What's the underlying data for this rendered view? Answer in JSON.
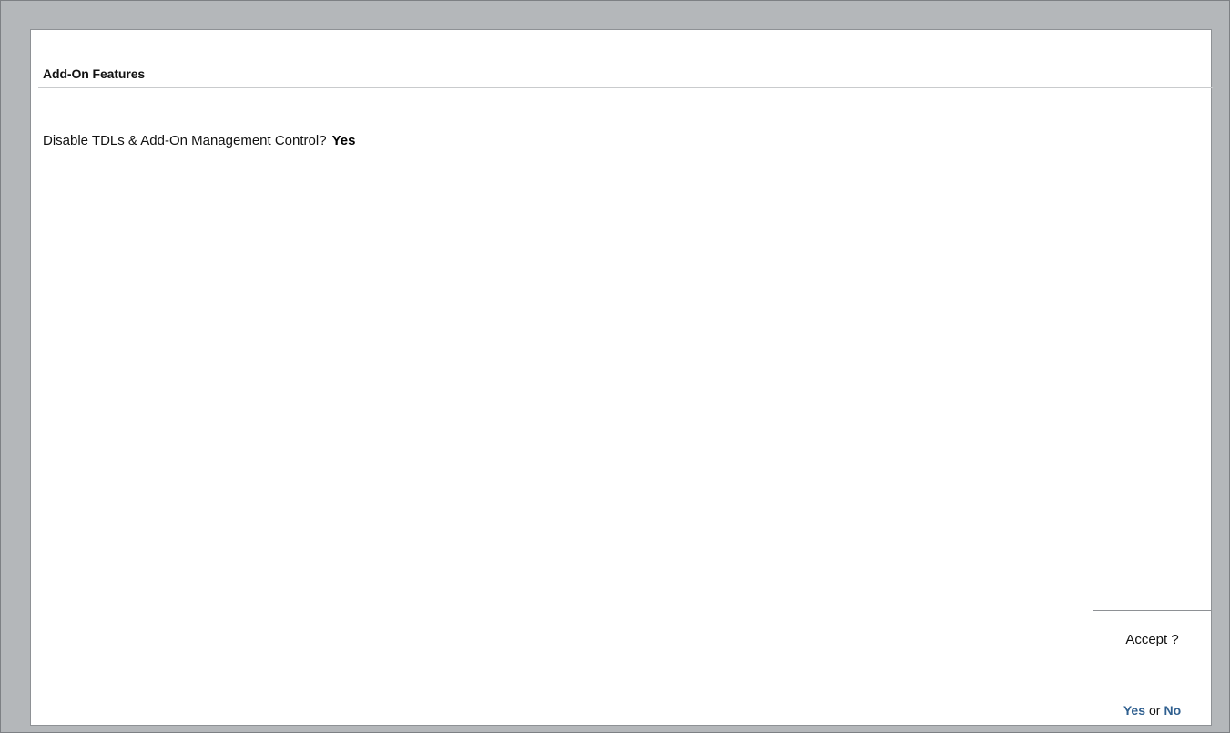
{
  "section": {
    "title": "Add-On Features"
  },
  "field": {
    "label": "Disable TDLs & Add-On Management Control?",
    "value": "Yes"
  },
  "accept_dialog": {
    "title": "Accept ?",
    "yes_label": "Yes",
    "or_text": "or",
    "no_label": "No"
  },
  "colors": {
    "frame": "#b4b7ba",
    "panel": "#ffffff",
    "option_text": "#2f5f8f"
  }
}
